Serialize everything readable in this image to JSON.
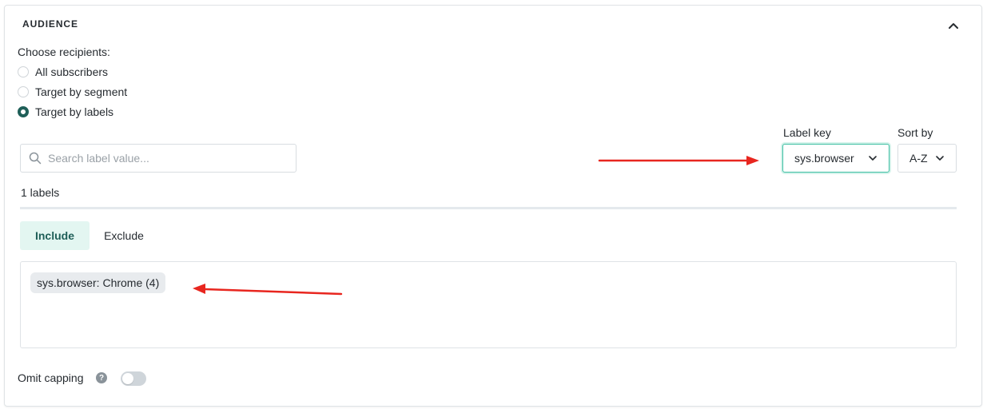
{
  "panel": {
    "title": "AUDIENCE"
  },
  "recipients": {
    "label": "Choose recipients:",
    "options": [
      {
        "label": "All subscribers",
        "checked": false
      },
      {
        "label": "Target by segment",
        "checked": false
      },
      {
        "label": "Target by labels",
        "checked": true
      }
    ]
  },
  "search": {
    "placeholder": "Search label value..."
  },
  "label_key": {
    "label": "Label key",
    "value": "sys.browser"
  },
  "sort_by": {
    "label": "Sort by",
    "value": "A-Z"
  },
  "labels_count": "1 labels",
  "tabs": [
    {
      "label": "Include",
      "active": true
    },
    {
      "label": "Exclude",
      "active": false
    }
  ],
  "selected_tags": [
    "sys.browser: Chrome (4)"
  ],
  "omit_capping": {
    "label": "Omit capping",
    "help": "?",
    "enabled": false
  },
  "colors": {
    "accent": "#1f5f58",
    "focus_border": "#3fbfa3",
    "active_tab_bg": "#e3f6f1",
    "annotation_arrow": "#e8261f"
  },
  "icons": {
    "collapse": "chevron-up-icon",
    "search": "search-icon",
    "dropdown": "chevron-down-icon"
  }
}
